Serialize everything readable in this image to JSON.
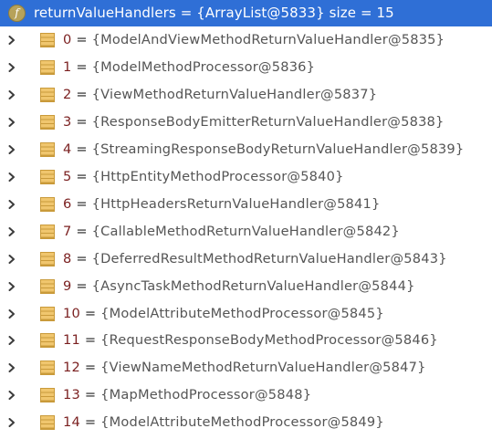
{
  "header": {
    "icon_letter": "f",
    "text": "returnValueHandlers = {ArrayList@5833}  size = 15",
    "colors": {
      "background": "#2f6fd6",
      "text": "#ffffff",
      "field_icon": "#b7a25a"
    }
  },
  "icons": {
    "expand": "chevron-right-icon",
    "element": "array-element-icon",
    "field": "field-icon"
  },
  "colors": {
    "index": "#7a1f1f",
    "value": "#555555",
    "element_icon": "#f0c66e"
  },
  "items": [
    {
      "index": "0",
      "value": "{ModelAndViewMethodReturnValueHandler@5835}"
    },
    {
      "index": "1",
      "value": "{ModelMethodProcessor@5836}"
    },
    {
      "index": "2",
      "value": "{ViewMethodReturnValueHandler@5837}"
    },
    {
      "index": "3",
      "value": "{ResponseBodyEmitterReturnValueHandler@5838}"
    },
    {
      "index": "4",
      "value": "{StreamingResponseBodyReturnValueHandler@5839}"
    },
    {
      "index": "5",
      "value": "{HttpEntityMethodProcessor@5840}"
    },
    {
      "index": "6",
      "value": "{HttpHeadersReturnValueHandler@5841}"
    },
    {
      "index": "7",
      "value": "{CallableMethodReturnValueHandler@5842}"
    },
    {
      "index": "8",
      "value": "{DeferredResultMethodReturnValueHandler@5843}"
    },
    {
      "index": "9",
      "value": "{AsyncTaskMethodReturnValueHandler@5844}"
    },
    {
      "index": "10",
      "value": "{ModelAttributeMethodProcessor@5845}"
    },
    {
      "index": "11",
      "value": "{RequestResponseBodyMethodProcessor@5846}"
    },
    {
      "index": "12",
      "value": "{ViewNameMethodReturnValueHandler@5847}"
    },
    {
      "index": "13",
      "value": "{MapMethodProcessor@5848}"
    },
    {
      "index": "14",
      "value": "{ModelAttributeMethodProcessor@5849}"
    }
  ]
}
